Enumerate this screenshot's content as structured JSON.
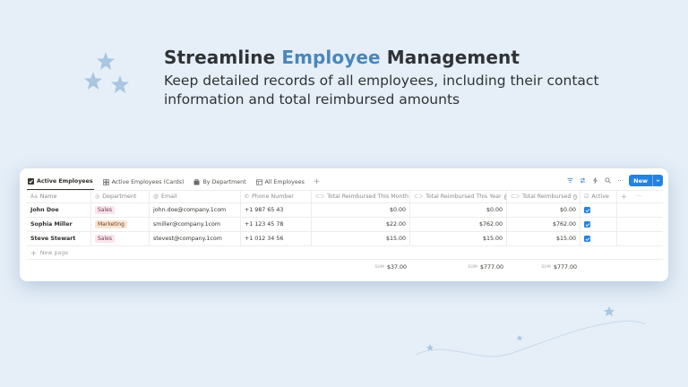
{
  "hero": {
    "title_part1": "Streamline ",
    "title_accent": "Employee",
    "title_part2": " Management",
    "subtitle": "Keep detailed records of all employees, including their contact information and total reimbursed amounts"
  },
  "colors": {
    "accent": "#4a86bb",
    "new_button": "#2383e2",
    "background": "#e6eff8"
  },
  "views": {
    "tabs": [
      {
        "label": "Active Employees",
        "icon": "checkbox-icon",
        "active": true
      },
      {
        "label": "Active Employees (Cards)",
        "icon": "gallery-icon",
        "active": false
      },
      {
        "label": "By Department",
        "icon": "board-icon",
        "active": false
      },
      {
        "label": "All Employees",
        "icon": "table-icon",
        "active": false
      }
    ],
    "add_label": "+"
  },
  "toolbar": {
    "new_label": "New",
    "icons": [
      "filter-icon",
      "sort-icon",
      "lightning-icon",
      "search-icon",
      "more-icon"
    ]
  },
  "table": {
    "columns": [
      {
        "label": "Name",
        "icon": "Aa"
      },
      {
        "label": "Department",
        "icon": "status-icon"
      },
      {
        "label": "Email",
        "icon": "at-icon"
      },
      {
        "label": "Phone Number",
        "icon": "phone-icon"
      },
      {
        "label": "Total Reimbursed This Month",
        "icon": "rollup-icon"
      },
      {
        "label": "Total Reimbursed This Year",
        "icon": "rollup-icon"
      },
      {
        "label": "Total Reimbursed",
        "icon": "rollup-icon"
      },
      {
        "label": "Active",
        "icon": "checkbox-icon"
      }
    ],
    "rows": [
      {
        "name": "John Doe",
        "department": "Sales",
        "email": "john.doe@company.1com",
        "phone": "+1 987 65 43",
        "month": "$0.00",
        "year": "$0.00",
        "total": "$0.00",
        "active": true
      },
      {
        "name": "Sophia Miller",
        "department": "Marketing",
        "email": "smiller@company.1com",
        "phone": "+1 123 45 78",
        "month": "$22.00",
        "year": "$762.00",
        "total": "$762.00",
        "active": true
      },
      {
        "name": "Steve Stewart",
        "department": "Sales",
        "email": "stevest@company.1com",
        "phone": "+1 012 34 56",
        "month": "$15.00",
        "year": "$15.00",
        "total": "$15.00",
        "active": true
      }
    ],
    "new_page_label": "New page",
    "sums": {
      "label": "SUM",
      "month": "$37.00",
      "year": "$777.00",
      "total": "$777.00"
    }
  }
}
